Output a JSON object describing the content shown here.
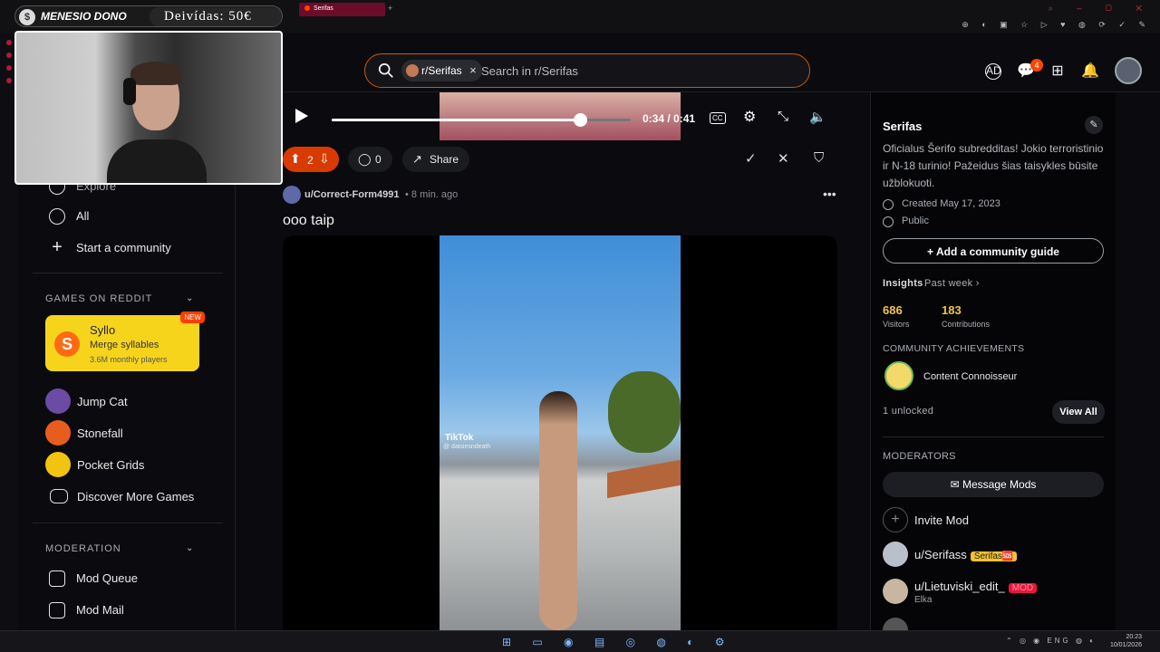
{
  "stream": {
    "donor_name": "MENESIO DONO",
    "debt_label": "Deivídas: 50€"
  },
  "browser": {
    "active_tab": "Serifas",
    "new_tab": "+"
  },
  "header": {
    "search_chip": "r/Serifas",
    "search_placeholder": "Search in r/Serifas",
    "chat_badge": "4",
    "icons": [
      "ads-icon",
      "chat-icon",
      "create-icon",
      "bell-icon"
    ]
  },
  "sidebar": {
    "nav": [
      {
        "label": "Explore",
        "icon": "explore-icon"
      },
      {
        "label": "All",
        "icon": "all-icon"
      },
      {
        "label": "Start a community",
        "icon": "plus-icon"
      }
    ],
    "games_heading": "GAMES ON REDDIT",
    "featured_game": {
      "title": "Syllo",
      "subtitle": "Merge syllables",
      "players": "3.6M monthly players",
      "badge": "NEW"
    },
    "games": [
      {
        "label": "Jump Cat"
      },
      {
        "label": "Stonefall"
      },
      {
        "label": "Pocket Grids"
      },
      {
        "label": "Discover More Games"
      }
    ],
    "moderation_heading": "MODERATION",
    "moderation": [
      {
        "label": "Mod Queue"
      },
      {
        "label": "Mod Mail"
      }
    ]
  },
  "player": {
    "time": "0:34 / 0:41",
    "progress": 0.83
  },
  "post_actions": {
    "votes": "2",
    "comments": "0",
    "share": "Share"
  },
  "post": {
    "author": "u/Correct-Form4991",
    "age": "• 8 min. ago",
    "title": "ooo taip",
    "watermark": "TikTok",
    "watermark_handle": "@ daisiesndeath"
  },
  "community": {
    "name": "Serifas",
    "description": "Oficialus Šerifo subredditas! Jokio terroristinio ir N-18 turinio! Pažeidus šias taisykles būsite užblokuoti.",
    "created": "Created May 17, 2023",
    "visibility": "Public",
    "guide_button": "+ Add a community guide",
    "insights_label": "Insights",
    "insights_range": "Past week ›",
    "visitors": "686",
    "visitors_label": "Visitors",
    "contributions": "183",
    "contributions_label": "Contributions",
    "achievements_heading": "COMMUNITY ACHIEVEMENTS",
    "achievement": "Content Connoisseur",
    "unlocked": "1 unlocked",
    "view_all": "View All",
    "moderators_heading": "MODERATORS",
    "message_mods": "Message Mods",
    "invite_mod": "Invite Mod",
    "mods": [
      {
        "name": "u/Serifass",
        "flair": "Šerifas🆘",
        "sub": ""
      },
      {
        "name": "u/Lietuviski_edit_",
        "flair": "MOD",
        "sub": "Elka"
      }
    ]
  },
  "taskbar": {
    "lang": "ENG",
    "time": "20:23",
    "date": "10/01/2026"
  }
}
